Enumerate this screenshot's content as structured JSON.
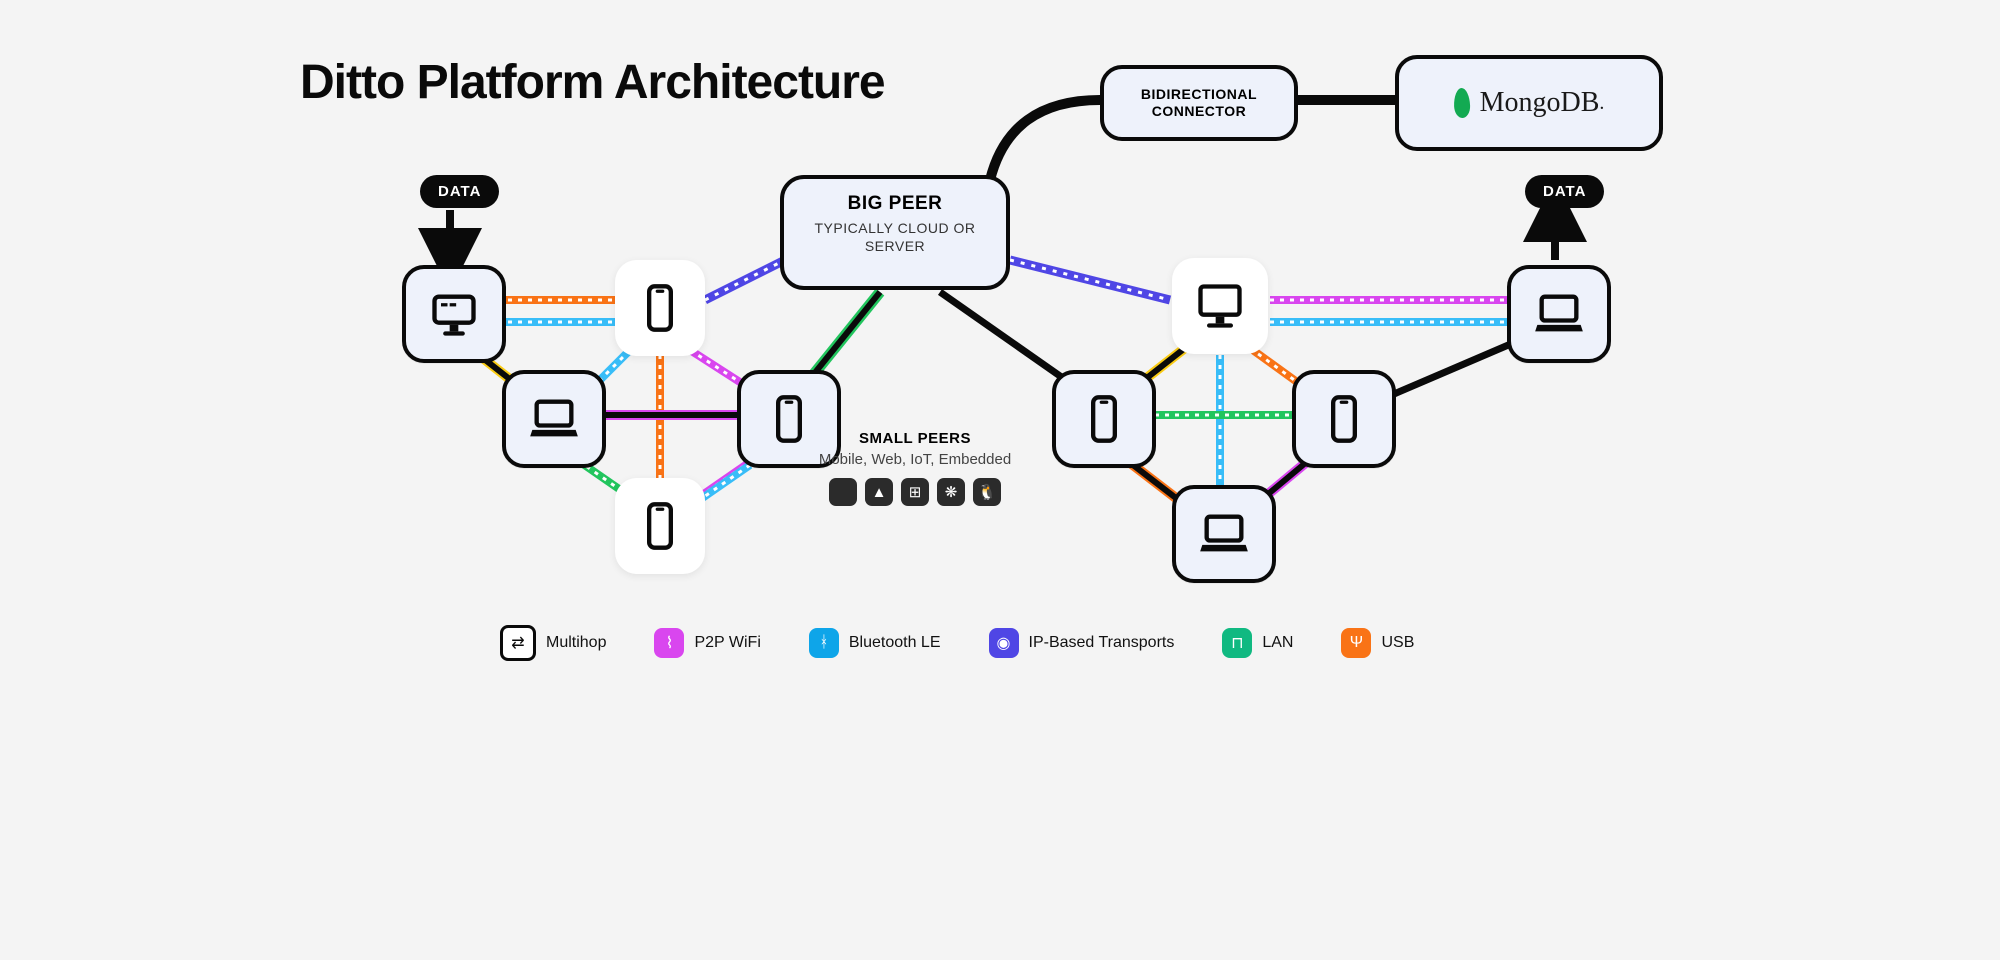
{
  "title": "Ditto Platform Architecture",
  "data_pill": "DATA",
  "big_peer": {
    "title": "BIG PEER",
    "subtitle": "TYPICALLY CLOUD OR SERVER"
  },
  "connector": {
    "line1": "BIDIRECTIONAL",
    "line2": "CONNECTOR"
  },
  "mongo": "MongoDB",
  "small_peers": {
    "title": "SMALL PEERS",
    "subtitle": "Mobile, Web, IoT, Embedded"
  },
  "os_icons": [
    "apple",
    "android",
    "windows",
    "raspberry-pi",
    "linux"
  ],
  "legend": [
    {
      "key": "multihop",
      "label": "Multihop",
      "color": "#0a0a0a"
    },
    {
      "key": "p2p-wifi",
      "label": "P2P WiFi",
      "color": "#d946ef"
    },
    {
      "key": "bluetooth-le",
      "label": "Bluetooth LE",
      "color": "#0ea5e9"
    },
    {
      "key": "ip-transports",
      "label": "IP-Based Transports",
      "color": "#4f46e5"
    },
    {
      "key": "lan",
      "label": "LAN",
      "color": "#10b981"
    },
    {
      "key": "usb",
      "label": "USB",
      "color": "#f97316"
    }
  ],
  "nodes": {
    "left_cluster": [
      "terminal",
      "phone",
      "laptop",
      "phone",
      "phone"
    ],
    "right_cluster": [
      "desktop",
      "laptop",
      "phone",
      "phone",
      "laptop"
    ]
  },
  "colors": {
    "multihop": "#0a0a0a",
    "wifi": "#d946ef",
    "bt": "#38bdf8",
    "ip": "#4f46e5",
    "lan": "#22c55e",
    "usb": "#f97316",
    "yellow": "#facc15"
  }
}
